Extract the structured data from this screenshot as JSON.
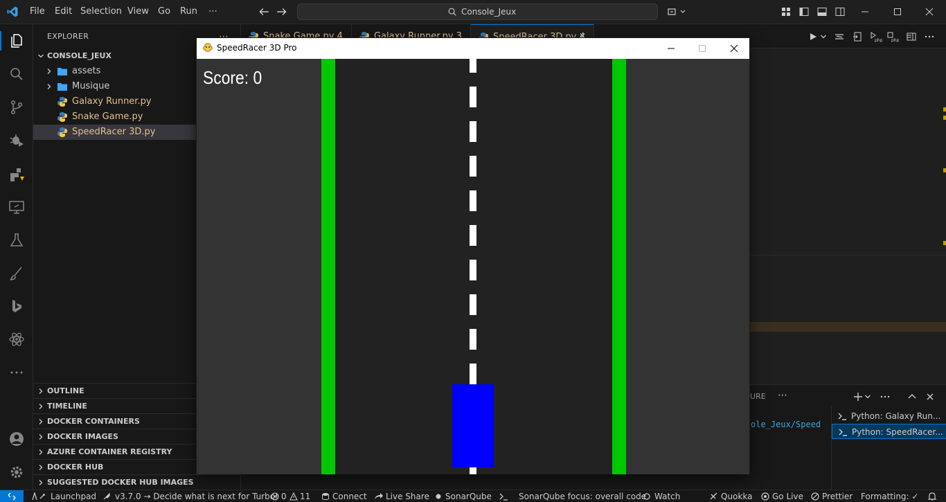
{
  "app": {
    "menu": [
      "File",
      "Edit",
      "Selection",
      "View",
      "Go",
      "Run",
      "⋯"
    ],
    "command_center": "Console_Jeux",
    "accent_color": "#0078d4"
  },
  "sidebar": {
    "title": "EXPLORER",
    "more": "⋯",
    "root_folder": "CONSOLE_JEUX",
    "items": [
      {
        "label": "assets",
        "type": "folder",
        "icon": "folder-icon"
      },
      {
        "label": "Musique",
        "type": "folder",
        "icon": "folder-icon"
      },
      {
        "label": "Galaxy Runner.py",
        "type": "file",
        "icon": "python-icon"
      },
      {
        "label": "Snake Game.py",
        "type": "file",
        "icon": "python-icon"
      },
      {
        "label": "SpeedRacer 3D.py",
        "type": "file",
        "icon": "python-icon",
        "selected": true
      }
    ],
    "sections": [
      "OUTLINE",
      "TIMELINE",
      "DOCKER CONTAINERS",
      "DOCKER IMAGES",
      "AZURE CONTAINER REGISTRY",
      "DOCKER HUB",
      "SUGGESTED DOCKER HUB IMAGES"
    ]
  },
  "tabs": [
    {
      "label": "Snake Game.py 4"
    },
    {
      "label": "Galaxy Runner.py 3"
    },
    {
      "label": "SpeedRacer 3D.py 4",
      "active": true,
      "close": "✕"
    }
  ],
  "panel": {
    "tab_fragment": "URE",
    "more": "⋯",
    "terminal_text": "ole_Jeux/Speed",
    "terminals": [
      {
        "label": "Python: Galaxy Run..."
      },
      {
        "label": "Python: SpeedRacer...",
        "selected": true
      }
    ]
  },
  "statusbar": {
    "launchpad": "Launchpad",
    "turbo": "v3.7.0 → Decide what is next for Turbo!",
    "errors": "0",
    "warnings": "11",
    "connect": "Connect",
    "live_share": "Live Share",
    "sonarqube": "SonarQube",
    "sonarqube_focus": "SonarQube focus: overall code",
    "watch": "Watch",
    "quokka": "Quokka",
    "go_live": "Go Live",
    "prettier": "Prettier",
    "formatting": "Formatting: ✓"
  },
  "game": {
    "window_title": "SpeedRacer 3D Pro",
    "score_text": "Score: 0",
    "colors": {
      "background": "#333333",
      "road": "#222222",
      "edge": "#00c800",
      "lane": "#ffffff",
      "car": "#0000ff"
    }
  }
}
